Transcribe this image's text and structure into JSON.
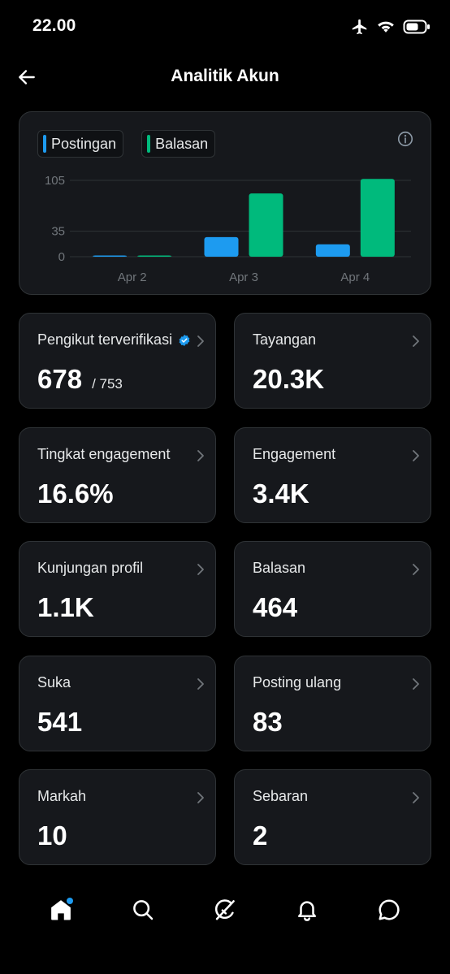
{
  "status_bar": {
    "time": "22.00",
    "icons": [
      "airplane-icon",
      "wifi-icon",
      "battery-icon"
    ]
  },
  "header": {
    "title": "Analitik Akun",
    "back_icon": "arrow-left-icon"
  },
  "chart_data": {
    "type": "bar",
    "categories": [
      "Apr 2",
      "Apr 3",
      "Apr 4"
    ],
    "series": [
      {
        "name": "Postingan",
        "color": "#1d9bf0",
        "values": [
          1,
          27,
          17
        ]
      },
      {
        "name": "Balasan",
        "color": "#00ba7c",
        "values": [
          1,
          87,
          107
        ]
      }
    ],
    "y_ticks": [
      "105",
      "35",
      "0"
    ],
    "y_tick_values": [
      105,
      35,
      0
    ],
    "ylim": [
      0,
      105
    ],
    "grid": true,
    "legend_position": "top-left"
  },
  "colors": {
    "background": "#000000",
    "card": "#16181c",
    "border": "#2f3336",
    "accent": "#1d9bf0",
    "success": "#00ba7c"
  },
  "stats": {
    "verified_followers": {
      "label": "Pengikut terverifikasi",
      "value": "678",
      "total": "/ 753"
    },
    "impressions": {
      "label": "Tayangan",
      "value": "20.3K"
    },
    "engagement_rate": {
      "label": "Tingkat engagement",
      "value": "16.6%"
    },
    "engagements": {
      "label": "Engagement",
      "value": "3.4K"
    },
    "profile_visits": {
      "label": "Kunjungan profil",
      "value": "1.1K"
    },
    "replies": {
      "label": "Balasan",
      "value": "464"
    },
    "likes": {
      "label": "Suka",
      "value": "541"
    },
    "reposts": {
      "label": "Posting ulang",
      "value": "83"
    },
    "bookmarks": {
      "label": "Markah",
      "value": "10"
    },
    "shares": {
      "label": "Sebaran",
      "value": "2"
    }
  },
  "bottom_nav": {
    "items": [
      "home-icon",
      "search-icon",
      "grok-icon",
      "notifications-icon",
      "messages-icon"
    ],
    "active": "home-icon"
  }
}
